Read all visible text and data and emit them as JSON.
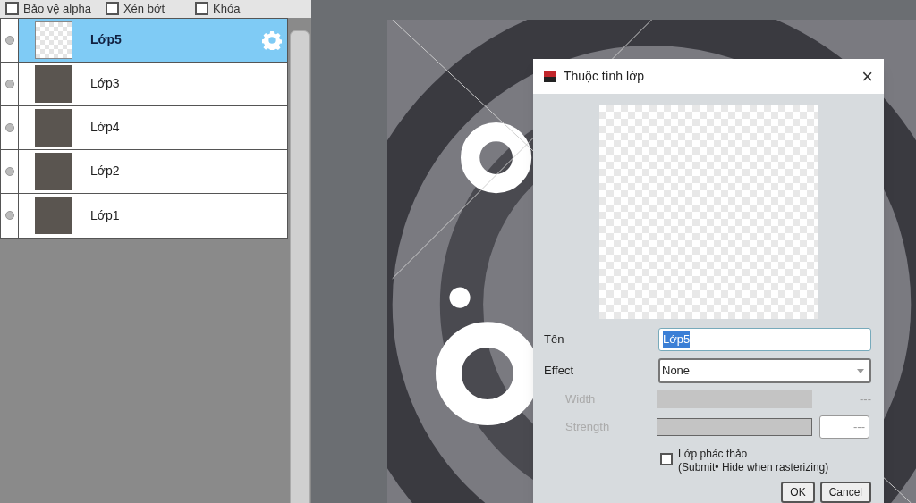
{
  "layer_options": [
    {
      "label": "Bảo vệ alpha",
      "checked": false
    },
    {
      "label": "Xén bớt",
      "checked": false
    },
    {
      "label": "Khóa",
      "checked": false
    }
  ],
  "layers": [
    {
      "name": "Lớp5",
      "selected": true,
      "kind": "transparent"
    },
    {
      "name": "Lớp3",
      "selected": false,
      "kind": "photo"
    },
    {
      "name": "Lớp4",
      "selected": false,
      "kind": "photo"
    },
    {
      "name": "Lớp2",
      "selected": false,
      "kind": "photo"
    },
    {
      "name": "Lớp1",
      "selected": false,
      "kind": "photo"
    }
  ],
  "dialog": {
    "title": "Thuộc tính lớp",
    "close": "×",
    "name_label": "Tên",
    "name_value": "Lớp5",
    "effect_label": "Effect",
    "effect_value": "None",
    "width_label": "Width",
    "width_value": "---",
    "width_disabled": true,
    "strength_disabled": true,
    "strength_label": "Strength",
    "strength_value": "---",
    "draft": {
      "label": "Lớp phác thảo",
      "note": "(Submit• Hide when rasterizing)",
      "checked": false
    },
    "buttons": [
      "OK",
      "Cancel"
    ]
  }
}
